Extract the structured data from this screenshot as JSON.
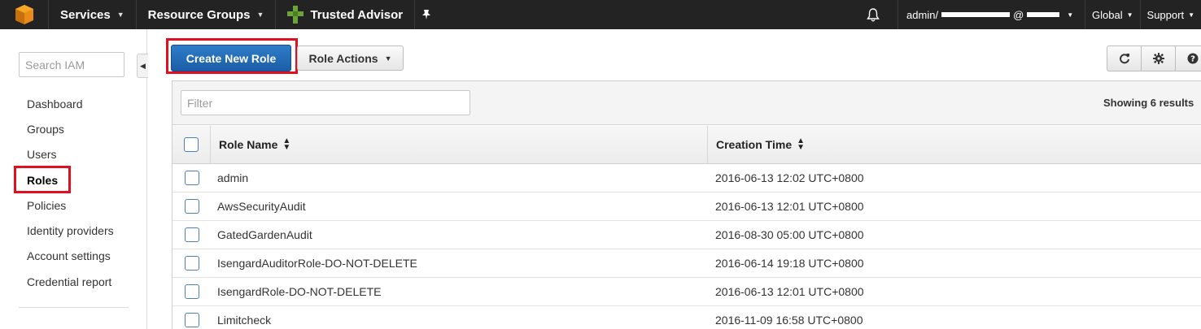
{
  "topbar": {
    "services_label": "Services",
    "resource_groups_label": "Resource Groups",
    "trusted_advisor_label": "Trusted Advisor",
    "account_label": "admin/",
    "account_suffix": "@",
    "region_label": "Global",
    "support_label": "Support"
  },
  "sidebar": {
    "search_placeholder": "Search IAM",
    "items": [
      {
        "label": "Dashboard"
      },
      {
        "label": "Groups"
      },
      {
        "label": "Users"
      },
      {
        "label": "Roles"
      },
      {
        "label": "Policies"
      },
      {
        "label": "Identity providers"
      },
      {
        "label": "Account settings"
      },
      {
        "label": "Credential report"
      }
    ]
  },
  "toolbar": {
    "create_label": "Create New Role",
    "actions_label": "Role Actions"
  },
  "filter": {
    "placeholder": "Filter",
    "results_label": "Showing 6 results"
  },
  "table": {
    "columns": [
      "Role Name",
      "Creation Time"
    ],
    "rows": [
      {
        "name": "admin",
        "time": "2016-06-13 12:02 UTC+0800"
      },
      {
        "name": "AwsSecurityAudit",
        "time": "2016-06-13 12:01 UTC+0800"
      },
      {
        "name": "GatedGardenAudit",
        "time": "2016-08-30 05:00 UTC+0800"
      },
      {
        "name": "IsengardAuditorRole-DO-NOT-DELETE",
        "time": "2016-06-14 19:18 UTC+0800"
      },
      {
        "name": "IsengardRole-DO-NOT-DELETE",
        "time": "2016-06-13 12:01 UTC+0800"
      },
      {
        "name": "Limitcheck",
        "time": "2016-11-09 16:58 UTC+0800"
      }
    ]
  },
  "colors": {
    "topbar_bg": "#232323",
    "primary_button": "#1f66b0",
    "highlight_border": "#e01020"
  }
}
